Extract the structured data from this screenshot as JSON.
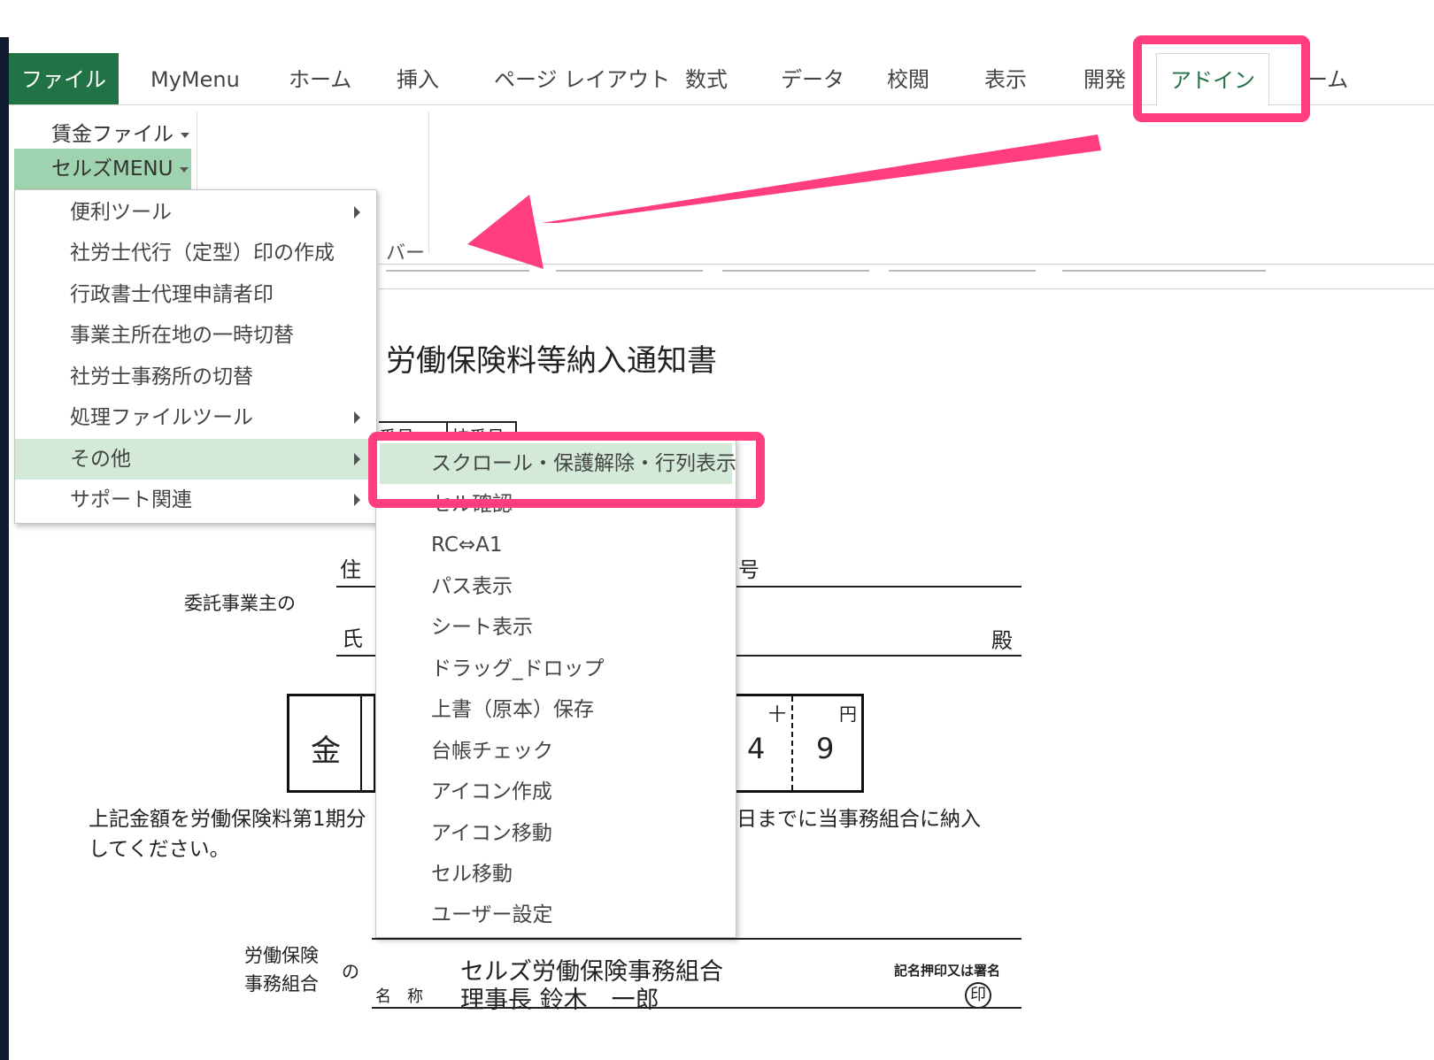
{
  "ribbon": {
    "tabs": [
      {
        "label": "ファイル"
      },
      {
        "label": "MyMenu"
      },
      {
        "label": "ホーム"
      },
      {
        "label": "挿入"
      },
      {
        "label": "ページ レイアウト"
      },
      {
        "label": "数式"
      },
      {
        "label": "データ"
      },
      {
        "label": "校閲"
      },
      {
        "label": "表示"
      },
      {
        "label": "開発"
      },
      {
        "label": "アドイン"
      },
      {
        "label": "ーム"
      }
    ],
    "group_buttons": {
      "wage_file": "賃金ファイル",
      "cells_menu": "セルズMENU"
    },
    "toolbar_fragment": "バー"
  },
  "cells_menu": {
    "items": [
      {
        "label": "便利ツール"
      },
      {
        "label": "社労士代行（定型）印の作成"
      },
      {
        "label": "行政書士代理申請者印"
      },
      {
        "label": "事業主所在地の一時切替"
      },
      {
        "label": "社労士事務所の切替"
      },
      {
        "label": "処理ファイルツール"
      },
      {
        "label": "その他"
      },
      {
        "label": "サポート関連"
      }
    ]
  },
  "other_submenu": {
    "items": [
      {
        "label": "スクロール・保護解除・行列表示"
      },
      {
        "label": "セル確認"
      },
      {
        "label": "RC⇔A1"
      },
      {
        "label": "パス表示"
      },
      {
        "label": "シート表示"
      },
      {
        "label": "ドラッグ_ドロップ"
      },
      {
        "label": "上書（原本）保存"
      },
      {
        "label": "台帳チェック"
      },
      {
        "label": "アイコン作成"
      },
      {
        "label": "アイコン移動"
      },
      {
        "label": "セル移動"
      },
      {
        "label": "ユーザー設定"
      }
    ]
  },
  "document": {
    "title": "労働保険料等納入通知書",
    "number_fragment_1": "番号",
    "number_fragment_2": "枝番号",
    "address_label": "住",
    "address_suffix": "号",
    "consignor_label": "委託事業主の",
    "name_label": "氏",
    "honorific": "殿",
    "amount_prefix": "金",
    "digit_tens_header": "十",
    "digit_yen_header": "円",
    "digit_tens_value": "4",
    "digit_yen_value": "9",
    "note_left": "上記金額を労働保険料第1期分",
    "note_right": "日までに当事務組合に納入",
    "note_line2": "してください。",
    "union_label_line1": "労働保険",
    "union_label_line2": "事務組合",
    "union_particle": "の",
    "union_name": "セルズ労働保険事務組合",
    "name_label_small": "名　称",
    "director": "理事長 鈴木　一郎",
    "seal_note": "記名押印又は署名",
    "seal": "印"
  }
}
